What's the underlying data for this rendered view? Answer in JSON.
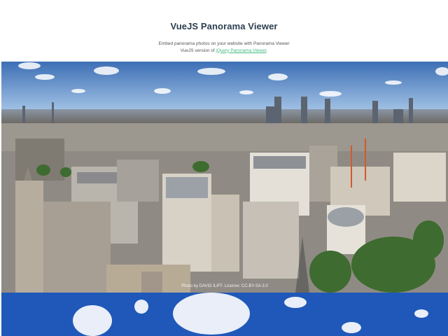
{
  "header": {
    "title": "VueJS Panorama Viewer",
    "desc_line1": "Embed panorama photos on your website with Panorama Viewer",
    "desc_line2_prefix": "VueJS version of ",
    "desc_link": "jQuery Panorama Viewer",
    "desc_line2_suffix": "."
  },
  "panorama_1": {
    "credit": "Photo by DAVID ILIFF. License: CC-BY-SA 3.0"
  },
  "colors": {
    "link": "#42b983",
    "title": "#2c3e50",
    "sky_top": "#3d6fb5",
    "sky_bottom": "#9ec1e6",
    "sky2": "#1f58b8"
  }
}
